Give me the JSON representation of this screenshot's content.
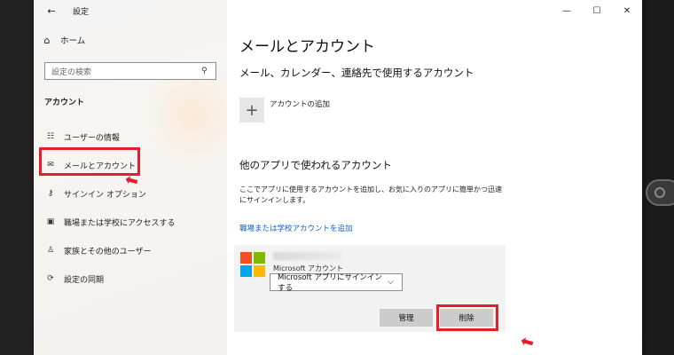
{
  "app": {
    "title": "設定",
    "back_icon": "back-arrow-icon"
  },
  "sidebar": {
    "home_label": "ホーム",
    "search_placeholder": "設定の検索",
    "section_title": "アカウント",
    "items": [
      {
        "label": "ユーザーの情報",
        "icon": "user-info-icon"
      },
      {
        "label": "メールとアカウント",
        "icon": "mail-icon",
        "selected": true
      },
      {
        "label": "サインイン オプション",
        "icon": "key-icon"
      },
      {
        "label": "職場または学校にアクセスする",
        "icon": "briefcase-icon"
      },
      {
        "label": "家族とその他のユーザー",
        "icon": "person-add-icon"
      },
      {
        "label": "設定の同期",
        "icon": "sync-icon"
      }
    ]
  },
  "main": {
    "title": "メールとアカウント",
    "section1": "メール、カレンダー、連絡先で使用するアカウント",
    "add_account": "アカウントの追加",
    "section2": "他のアプリで使われるアカウント",
    "description": "ここでアプリに使用するアカウントを追加し、お気に入りのアプリに簡単かつ迅速にサインインします。",
    "work_school_link": "職場または学校アカウントを追加",
    "account_card": {
      "account_type": "Microsoft アカウント",
      "selected_option": "Microsoft アプリにサインインする",
      "manage_label": "管理",
      "remove_label": "削除"
    }
  },
  "colors": {
    "accent": "#0078d7",
    "highlight": "#e41e2b",
    "link": "#0a61c2"
  }
}
